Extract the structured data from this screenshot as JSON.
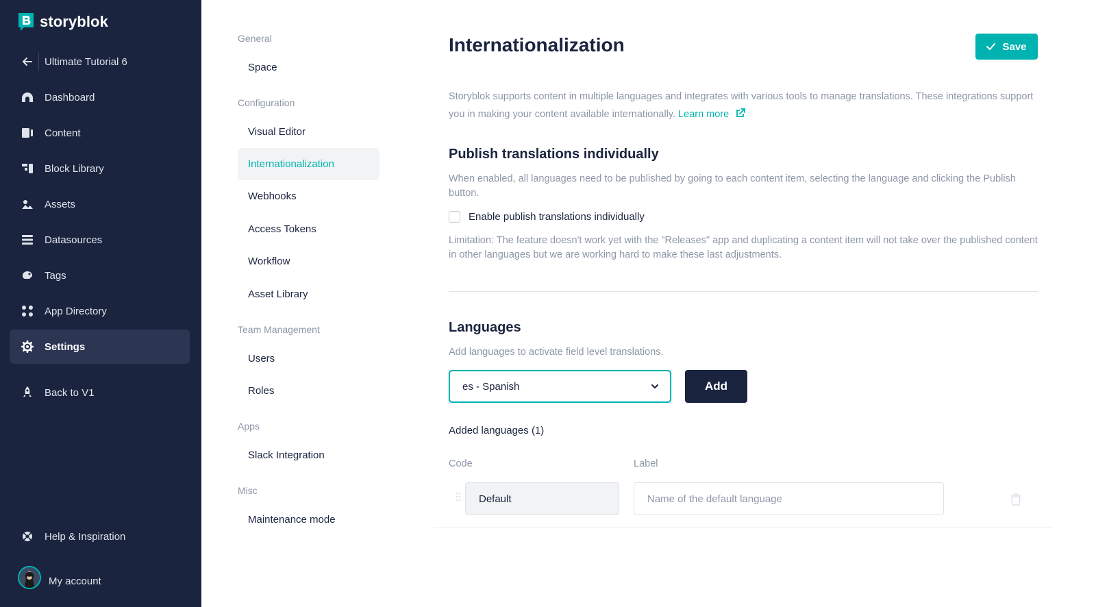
{
  "app": {
    "brand": "storyblok",
    "accent_color": "#00b3b0",
    "sidebar_color": "#1b243f"
  },
  "sidebar": {
    "space_name": "Ultimate Tutorial 6",
    "items": [
      {
        "label": "Dashboard",
        "icon": "dashboard-icon"
      },
      {
        "label": "Content",
        "icon": "content-icon"
      },
      {
        "label": "Block Library",
        "icon": "block-library-icon"
      },
      {
        "label": "Assets",
        "icon": "assets-icon"
      },
      {
        "label": "Datasources",
        "icon": "datasources-icon"
      },
      {
        "label": "Tags",
        "icon": "tag-icon"
      },
      {
        "label": "App Directory",
        "icon": "app-directory-icon"
      },
      {
        "label": "Settings",
        "icon": "gear-icon"
      },
      {
        "label": "Back to V1",
        "icon": "rocket-icon"
      }
    ],
    "help_label": "Help & Inspiration",
    "account_label": "My account"
  },
  "settings_nav": {
    "sections": [
      {
        "heading": "General",
        "items": [
          "Space"
        ]
      },
      {
        "heading": "Configuration",
        "items": [
          "Visual Editor",
          "Internationalization",
          "Webhooks",
          "Access Tokens",
          "Workflow",
          "Asset Library"
        ]
      },
      {
        "heading": "Team Management",
        "items": [
          "Users",
          "Roles"
        ]
      },
      {
        "heading": "Apps",
        "items": [
          "Slack Integration"
        ]
      },
      {
        "heading": "Misc",
        "items": [
          "Maintenance mode"
        ]
      }
    ],
    "active_item": "Internationalization"
  },
  "main": {
    "title": "Internationalization",
    "save_label": "Save",
    "intro_text": "Storyblok supports content in multiple languages and integrates with various tools to manage translations. These integrations support you in making your content available internationally.",
    "learn_more_label": "Learn more",
    "publish": {
      "heading": "Publish translations individually",
      "description": "When enabled, all languages need to be published by going to each content item, selecting the language and clicking the Publish button.",
      "checkbox_label": "Enable publish translations individually",
      "checkbox_checked": false,
      "limitation": "Limitation: The feature doesn't work yet with the \"Releases\" app and duplicating a content item will not take over the published content in other languages but we are working hard to make these last adjustments."
    },
    "languages": {
      "heading": "Languages",
      "description": "Add languages to activate field level translations.",
      "selected_language": "es - Spanish",
      "add_label": "Add",
      "added_title": "Added languages (1)",
      "col_code": "Code",
      "col_label": "Label",
      "rows": [
        {
          "code": "Default",
          "label_value": "",
          "label_placeholder": "Name of the default language"
        }
      ]
    }
  }
}
